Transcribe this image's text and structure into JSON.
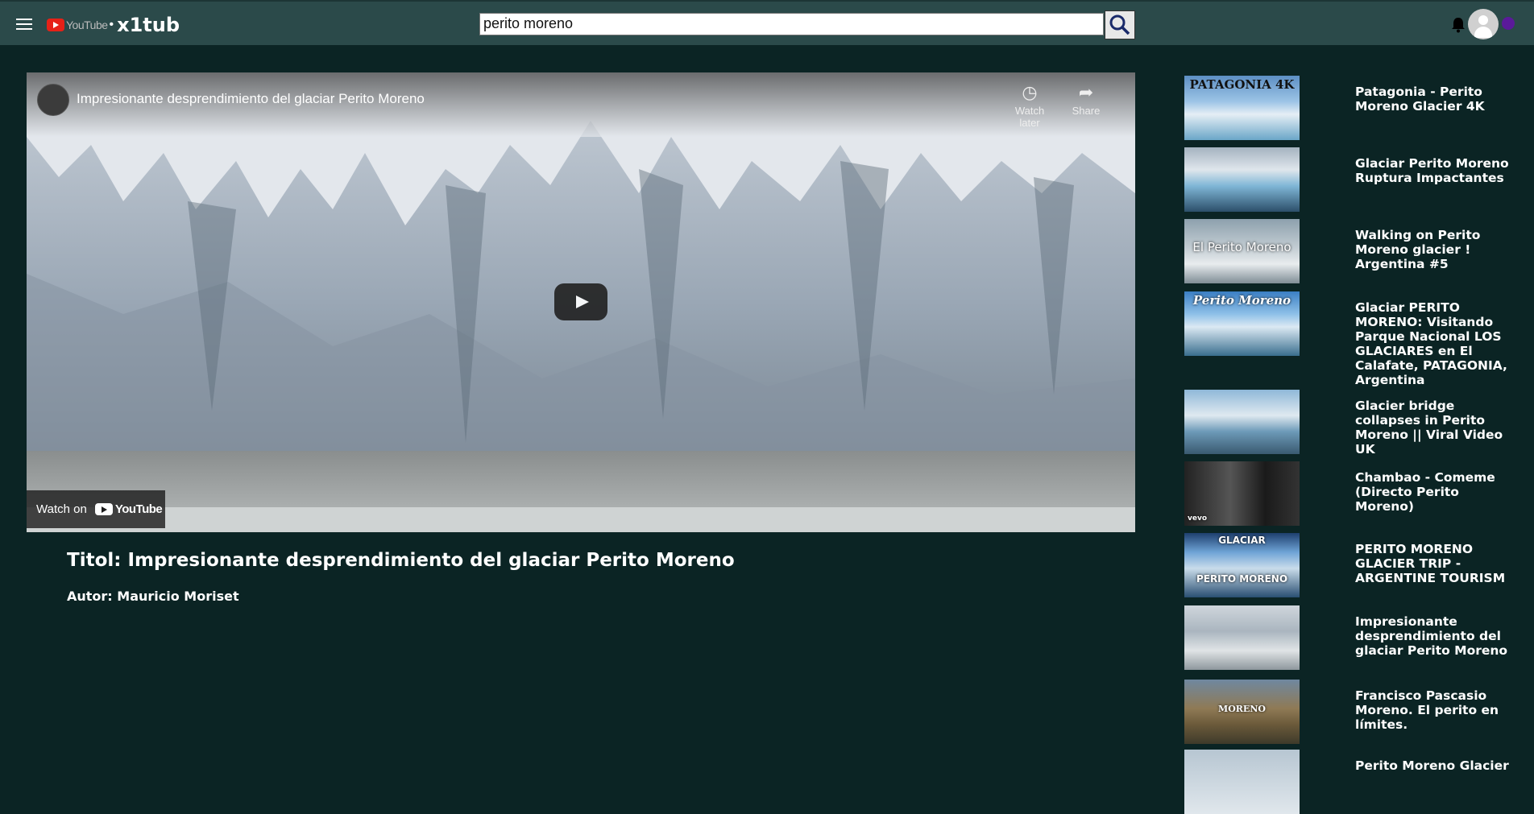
{
  "header": {
    "logo_word": "YouTube",
    "brand": "x1tub",
    "search_value": "perito moreno"
  },
  "player": {
    "video_title": "Impresionante desprendimiento del glaciar Perito Moreno",
    "watch_later_label": "Watch later",
    "share_label": "Share",
    "watch_on_label": "Watch on",
    "watch_on_brand": "YouTube"
  },
  "info": {
    "title": "Titol: Impresionante desprendimiento del glaciar Perito Moreno",
    "author": "Autor: Mauricio Moriset"
  },
  "related": [
    {
      "title": "Patagonia - Perito Moreno Glacier 4K",
      "thumb_text": "PATAGONIA   4K"
    },
    {
      "title": "Glaciar Perito Moreno Ruptura Impactantes",
      "thumb_text": ""
    },
    {
      "title": "Walking on Perito Moreno glacier ! Argentina #5",
      "thumb_text": "El Perito Moreno"
    },
    {
      "title": "Glaciar PERITO MORENO: Visitando Parque Nacional LOS GLACIARES en El Calafate, PATAGONIA, Argentina",
      "thumb_text": "Perito Moreno"
    },
    {
      "title": "Glacier bridge collapses in Perito Moreno || Viral Video UK",
      "thumb_text": ""
    },
    {
      "title": "Chambao - Comeme (Directo Perito Moreno)",
      "thumb_text": "vevo"
    },
    {
      "title": "PERITO MORENO GLACIER TRIP - ARGENTINE TOURISM",
      "thumb_text": "GLACIAR",
      "thumb_text2": "PERITO MORENO"
    },
    {
      "title": "Impresionante desprendimiento del glaciar Perito Moreno",
      "thumb_text": ""
    },
    {
      "title": "Francisco Pascasio Moreno. El perito en límites.",
      "thumb_text": "MORENO"
    },
    {
      "title": "Perito Moreno Glacier",
      "thumb_text": ""
    }
  ]
}
